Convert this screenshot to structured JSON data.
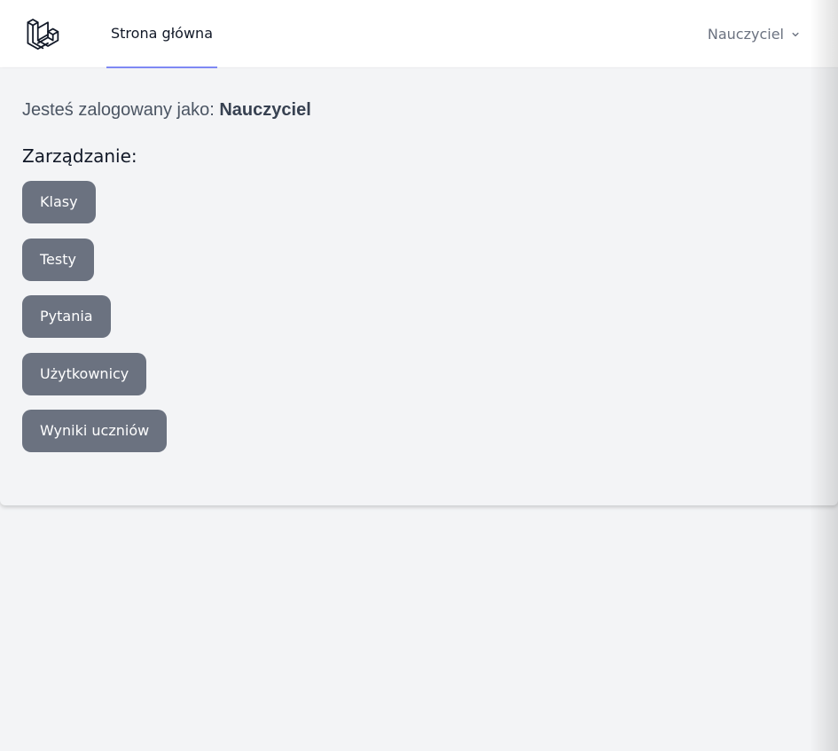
{
  "header": {
    "logo_icon": "laravel-logo-icon",
    "nav_link": "Strona główna",
    "user_name": "Nauczyciel",
    "user_menu_icon": "chevron-down-icon",
    "active_underline_color": "#818cf8"
  },
  "main": {
    "logged_in_prefix": "Jesteś zalogowany jako:",
    "logged_in_role": "Nauczyciel",
    "section_title": "Zarządzanie:",
    "buttons": [
      "Klasy",
      "Testy",
      "Pytania",
      "Użytkownicy",
      "Wyniki uczniów"
    ],
    "button_color": "#6b7280",
    "background_color": "#f3f4f6"
  }
}
